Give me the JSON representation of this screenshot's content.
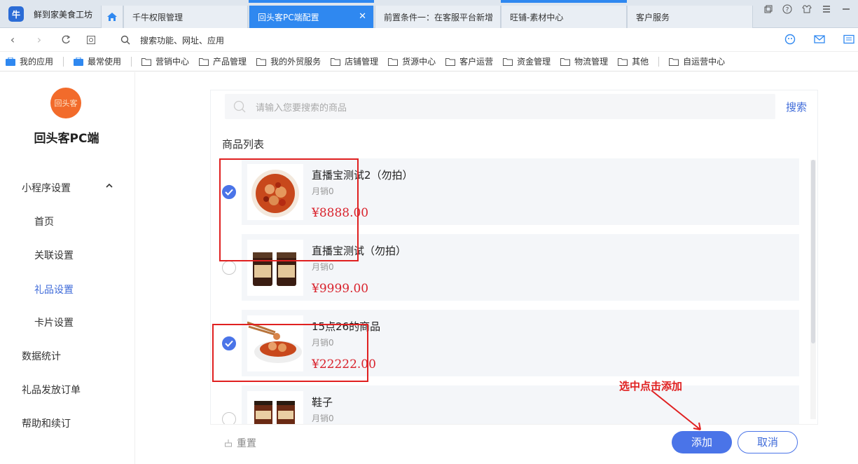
{
  "browser": {
    "shop_name": "鲜到家美食工坊",
    "tabs": [
      {
        "label": "千牛权限管理"
      },
      {
        "label": "回头客PC端配置",
        "active": true
      },
      {
        "label": "前置条件一：在客服平台新增"
      },
      {
        "label": "旺铺-素材中心"
      },
      {
        "label": "客户服务"
      }
    ],
    "address_placeholder": "搜索功能、网址、应用",
    "bookmarks": [
      "我的应用",
      "最常使用",
      "营销中心",
      "产品管理",
      "我的外贸服务",
      "店铺管理",
      "货源中心",
      "客户运营",
      "资金管理",
      "物流管理",
      "其他",
      "自运营中心"
    ]
  },
  "sidebar": {
    "logo_text": "回头客",
    "brand": "回头客PC端",
    "group": "小程序设置",
    "sub_items": [
      "首页",
      "关联设置",
      "礼品设置",
      "卡片设置"
    ],
    "active_sub": "礼品设置",
    "items": [
      "数据统计",
      "礼品发放订单",
      "帮助和续订"
    ]
  },
  "main": {
    "search_placeholder": "请输入您要搜索的商品",
    "search_btn": "搜索",
    "list_title": "商品列表",
    "products": [
      {
        "name": "直播宝测试2（勿拍）",
        "sales": "月销0",
        "price": "¥8888.00",
        "checked": true
      },
      {
        "name": "直播宝测试（勿拍）",
        "sales": "月销0",
        "price": "¥9999.00",
        "checked": false
      },
      {
        "name": "15点26的商品",
        "sales": "月销0",
        "price": "¥22222.00",
        "checked": true
      },
      {
        "name": "鞋子",
        "sales": "月销0",
        "price": "",
        "checked": false
      }
    ],
    "reset_btn": "重置",
    "add_btn": "添加",
    "cancel_btn": "取消",
    "annotation": "选中点击添加"
  },
  "colors": {
    "accent": "#4a74e8",
    "price": "#d9232d",
    "annotation": "#e02020",
    "tab_active": "#2f88f0"
  }
}
